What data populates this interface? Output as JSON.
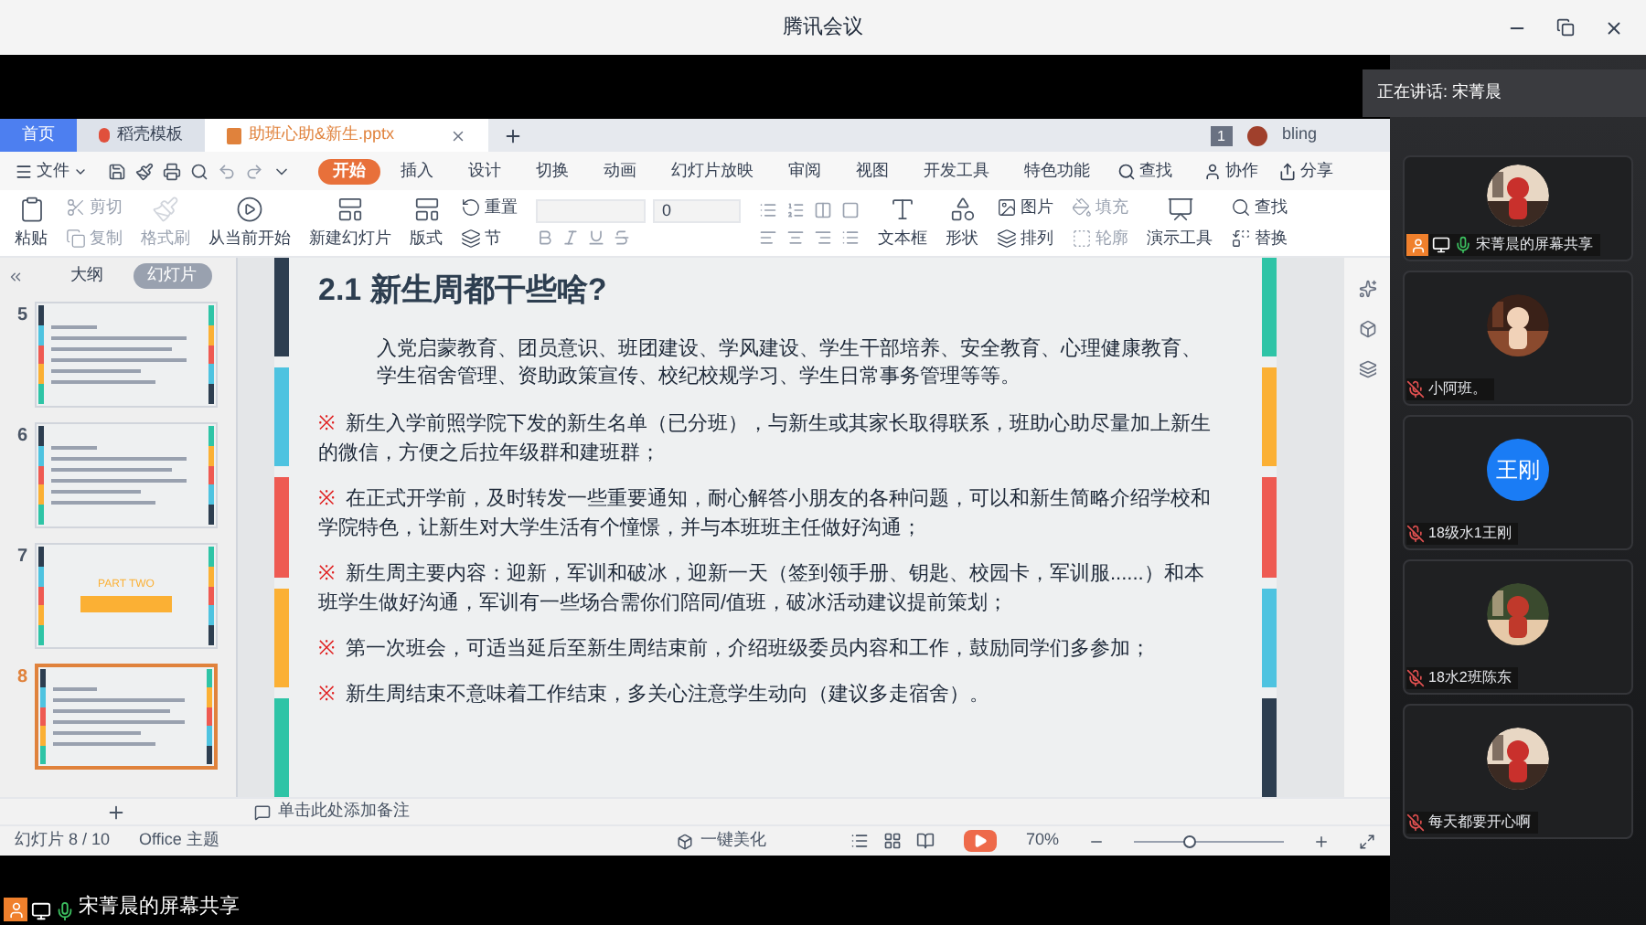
{
  "window": {
    "title": "腾讯会议"
  },
  "speaking": {
    "label": "正在讲话: 宋菁晨"
  },
  "wps": {
    "tabs": [
      {
        "label": "首页",
        "kind": "home",
        "selected": false
      },
      {
        "label": "稻壳模板",
        "kind": "docer",
        "selected": false
      },
      {
        "label": "助班心助&新生.pptx",
        "kind": "file",
        "selected": true
      }
    ],
    "badge": "1",
    "user": "bling",
    "menu_file": "文件",
    "menu": [
      {
        "label": "开始",
        "selected": true
      },
      {
        "label": "插入",
        "selected": false
      },
      {
        "label": "设计",
        "selected": false
      },
      {
        "label": "切换",
        "selected": false
      },
      {
        "label": "动画",
        "selected": false
      },
      {
        "label": "幻灯片放映",
        "selected": false
      },
      {
        "label": "审阅",
        "selected": false
      },
      {
        "label": "视图",
        "selected": false
      },
      {
        "label": "开发工具",
        "selected": false
      },
      {
        "label": "特色功能",
        "selected": false
      }
    ],
    "menu_search": "查找",
    "menu_right": [
      "协作",
      "分享"
    ],
    "ribbon": [
      {
        "kind": "large",
        "items": [
          {
            "label": "粘贴",
            "disabled": false
          }
        ]
      },
      {
        "kind": "stack",
        "items": [
          {
            "label": "剪切",
            "disabled": true
          },
          {
            "label": "复制",
            "disabled": true
          }
        ]
      },
      {
        "kind": "large",
        "items": [
          {
            "label": "格式刷",
            "disabled": true
          }
        ]
      },
      {
        "kind": "large",
        "items": [
          {
            "label": "从当前开始",
            "disabled": false
          }
        ]
      },
      {
        "kind": "large",
        "items": [
          {
            "label": "新建幻灯片",
            "disabled": false
          }
        ]
      },
      {
        "kind": "large",
        "items": [
          {
            "label": "版式",
            "disabled": false
          }
        ]
      },
      {
        "kind": "stack",
        "items": [
          {
            "label": "重置",
            "disabled": false
          },
          {
            "label": "节",
            "disabled": false
          }
        ]
      },
      {
        "kind": "font",
        "font_size": "0"
      },
      {
        "kind": "paragraph"
      },
      {
        "kind": "large",
        "items": [
          {
            "label": "文本框",
            "disabled": false
          }
        ]
      },
      {
        "kind": "large",
        "items": [
          {
            "label": "形状",
            "disabled": false
          }
        ]
      },
      {
        "kind": "stack",
        "items": [
          {
            "label": "图片",
            "disabled": false
          },
          {
            "label": "排列",
            "disabled": false
          }
        ]
      },
      {
        "kind": "stack",
        "items": [
          {
            "label": "填充",
            "disabled": true
          },
          {
            "label": "轮廓",
            "disabled": true
          }
        ]
      },
      {
        "kind": "large",
        "items": [
          {
            "label": "演示工具",
            "disabled": false
          }
        ]
      },
      {
        "kind": "stack",
        "items": [
          {
            "label": "查找",
            "disabled": false
          },
          {
            "label": "替换",
            "disabled": false
          }
        ]
      }
    ],
    "panel_tabs": [
      {
        "label": "大纲",
        "selected": false
      },
      {
        "label": "幻灯片",
        "selected": true
      }
    ],
    "thumbnails": [
      {
        "number": "5",
        "kind": "text",
        "selected": false
      },
      {
        "number": "6",
        "kind": "text",
        "selected": false
      },
      {
        "number": "7",
        "kind": "section",
        "heading": "PART TWO",
        "selected": false
      },
      {
        "number": "8",
        "kind": "text",
        "selected": true
      }
    ],
    "slide": {
      "title": "2.1 新生周都干些啥?",
      "intro": "入党启蒙教育、团员意识、班团建设、学风建设、学生干部培养、安全教育、心理健康教育、学生宿舍管理、资助政策宣传、校纪校规学习、学生日常事务管理等等。",
      "bullets": [
        {
          "marker": "※",
          "text": "新生入学前照学院下发的新生名单（已分班），与新生或其家长取得联系，班助心助尽量加上新生的微信，方便之后拉年级群和建班群；"
        },
        {
          "marker": "※",
          "text": "在正式开学前，及时转发一些重要通知，耐心解答小朋友的各种问题，可以和新生简略介绍学校和学院特色，让新生对大学生活有个憧憬，并与本班班主任做好沟通；"
        },
        {
          "marker": "※",
          "text": "新生周主要内容：迎新，军训和破冰，迎新一天（签到领手册、钥匙、校园卡，军训服......）和本班学生做好沟通，军训有一些场合需你们陪同/值班，破冰活动建议提前策划；"
        },
        {
          "marker": "※",
          "text": "第一次班会，可适当延后至新生周结束前，介绍班级委员内容和工作，鼓励同学们多参加；"
        },
        {
          "marker": "※",
          "text": "新生周结束不意味着工作结束，多关心注意学生动向（建议多走宿舍）。"
        }
      ]
    },
    "notes_placeholder": "单击此处添加备注",
    "status": {
      "slide_count": "幻灯片 8 / 10",
      "theme": "Office 主题",
      "beautify": "一键美化",
      "zoom": "70%",
      "zoom_slider": {
        "level": 0.33
      }
    }
  },
  "participants": [
    {
      "name": "宋菁晨的屏幕共享",
      "muted": false,
      "sharing": true
    },
    {
      "name": "小阿班。",
      "muted": true,
      "sharing": false
    },
    {
      "name": "18级水1王刚",
      "muted": true,
      "sharing": false,
      "avatar": {
        "kind": "initials",
        "text": "王刚"
      }
    },
    {
      "name": "18水2班陈东",
      "muted": true,
      "sharing": false
    },
    {
      "name": "每天都要开心啊",
      "muted": true,
      "sharing": false
    }
  ],
  "share_label": "宋菁晨的屏幕共享"
}
